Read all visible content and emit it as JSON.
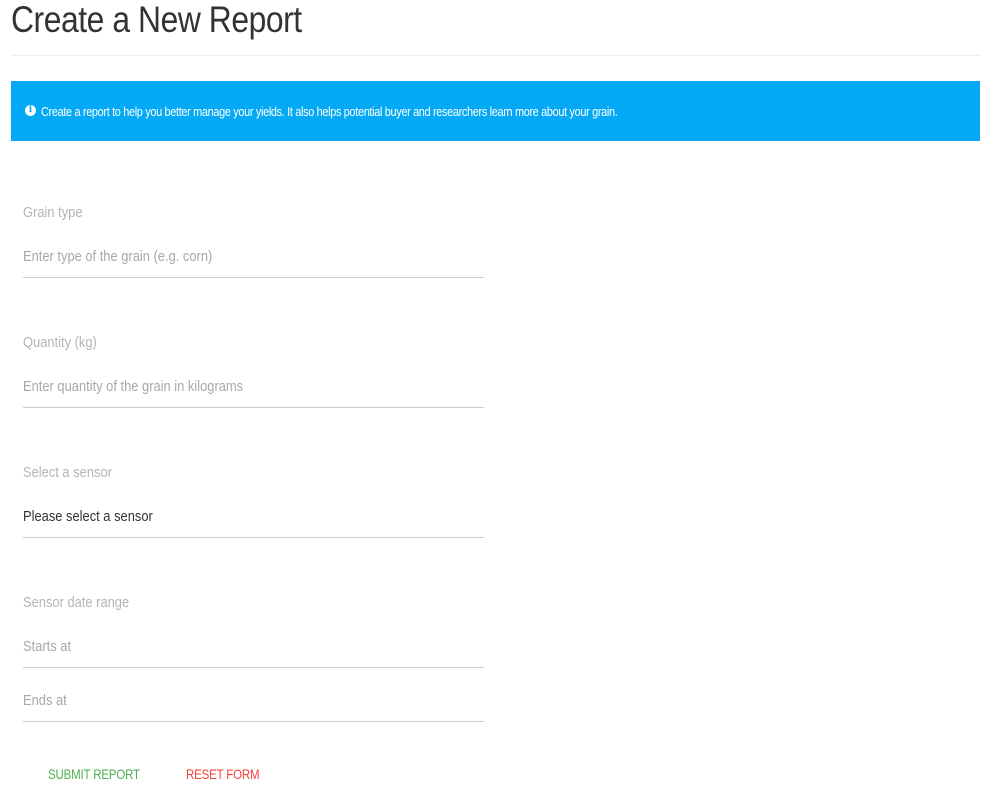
{
  "page": {
    "title": "Create a New Report"
  },
  "info_banner": {
    "icon": "info-icon",
    "icon_glyph": "i",
    "text": "Create a report to help you better manage your yields. It also helps potential buyer and researchers learn more about your grain.",
    "background_color": "#03a9f4"
  },
  "form": {
    "grain_type": {
      "label": "Grain type",
      "placeholder": "Enter type of the grain (e.g. corn)",
      "value": ""
    },
    "quantity": {
      "label": "Quantity (kg)",
      "placeholder": "Enter quantity of the grain in kilograms",
      "value": ""
    },
    "sensor": {
      "label": "Select a sensor",
      "selected": "Please select a sensor"
    },
    "date_range": {
      "label": "Sensor date range",
      "starts_placeholder": "Starts at",
      "ends_placeholder": "Ends at"
    }
  },
  "actions": {
    "submit_label": "SUBMIT REPORT",
    "reset_label": "RESET FORM",
    "submit_color": "#4caf50",
    "reset_color": "#f44336"
  }
}
